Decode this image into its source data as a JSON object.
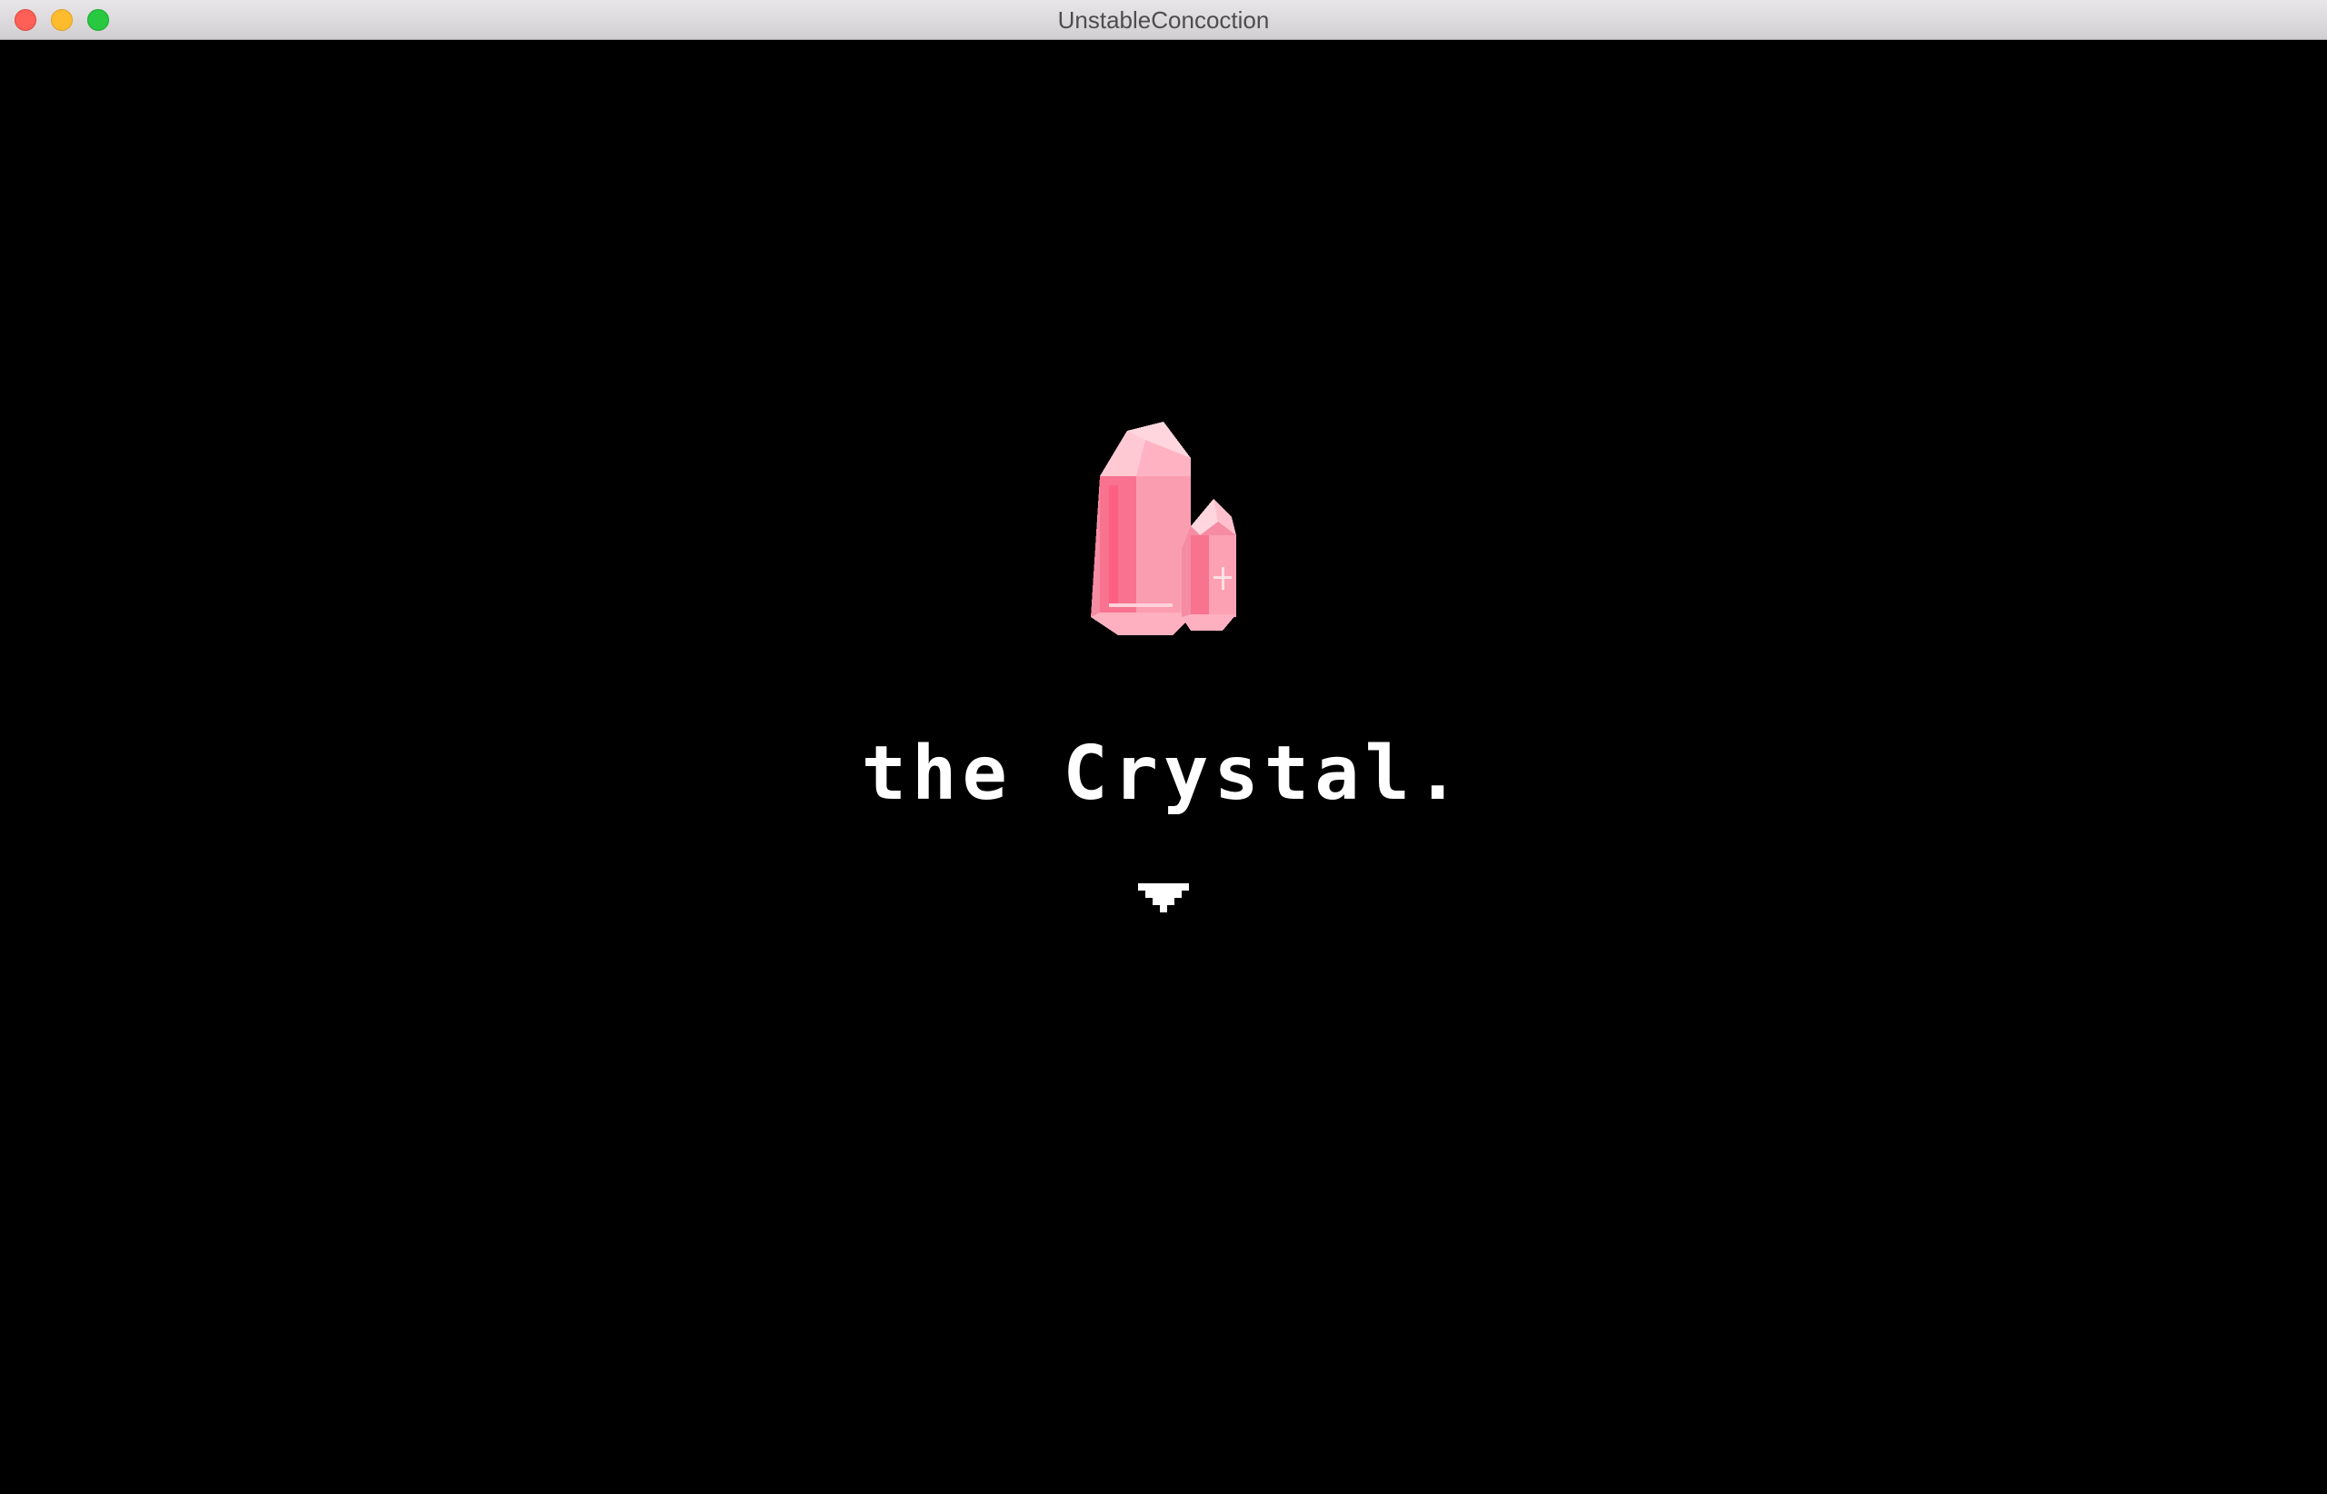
{
  "window": {
    "title": "UnstableConcoction"
  },
  "game": {
    "caption": "the Crystal."
  },
  "colors": {
    "background": "#000000",
    "caption_text": "#ffffff",
    "crystal_light": "#ff9fb2",
    "crystal_mid": "#f7738f",
    "crystal_dark": "#e35476",
    "crystal_highlight": "#ffd6de"
  },
  "icons": {
    "crystal": "pink-crystal-sprite",
    "advance": "down-arrow-icon"
  }
}
